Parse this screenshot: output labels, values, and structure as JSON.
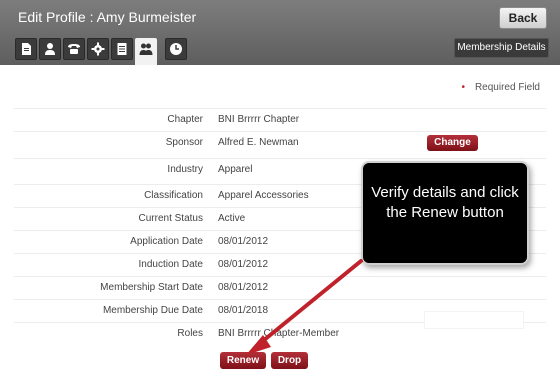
{
  "header": {
    "title": "Edit Profile : Amy Burmeister",
    "back_label": "Back",
    "membership_details_label": "Membership Details"
  },
  "tabs": [
    {
      "icon": "document-icon"
    },
    {
      "icon": "person-icon"
    },
    {
      "icon": "phone-icon"
    },
    {
      "icon": "gear-icon"
    },
    {
      "icon": "list-document-icon"
    },
    {
      "icon": "group-icon",
      "active": true
    },
    {
      "icon": "clock-icon"
    }
  ],
  "required_label": "Required Field",
  "form": {
    "rows": [
      {
        "label": "Chapter",
        "value": "BNI Brrrrr Chapter"
      },
      {
        "label": "Sponsor",
        "value": "Alfred E. Newman"
      },
      {
        "label": "Industry",
        "value": "Apparel"
      },
      {
        "label": "Classification",
        "value": "Apparel Accessories"
      },
      {
        "label": "Current Status",
        "value": "Active"
      },
      {
        "label": "Application Date",
        "value": "08/01/2012"
      },
      {
        "label": "Induction Date",
        "value": "08/01/2012"
      },
      {
        "label": "Membership Start Date",
        "value": "08/01/2012"
      },
      {
        "label": "Membership Due Date",
        "value": "08/01/2018"
      },
      {
        "label": "Roles",
        "value": "BNI Brrrrr Chapter-Member"
      }
    ],
    "change_label": "Change",
    "renew_label": "Renew",
    "drop_label": "Drop"
  },
  "callout": {
    "text": "Verify details and click the Renew button"
  },
  "colors": {
    "accent": "#9b1c24",
    "header": "#6b6b6b",
    "arrow": "#c0222b"
  }
}
